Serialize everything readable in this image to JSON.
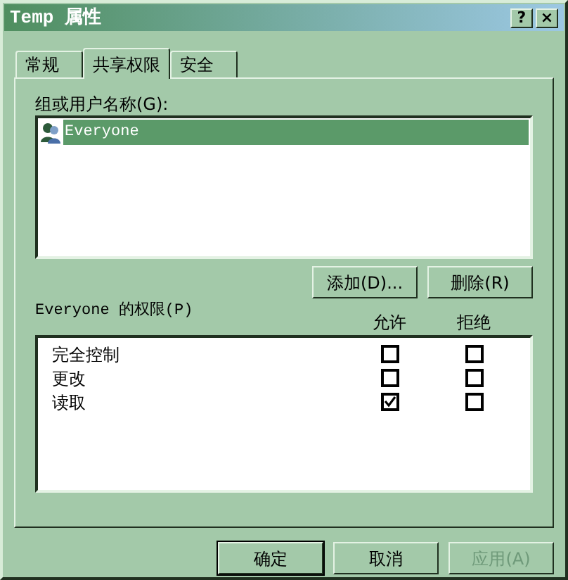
{
  "window": {
    "title": "Temp 属性",
    "controls": [
      "?",
      "×"
    ]
  },
  "tabs": [
    {
      "label": "常规",
      "selected": false
    },
    {
      "label": "共享权限",
      "selected": true
    },
    {
      "label": "安全",
      "selected": false
    }
  ],
  "group_label": "组或用户名称(G):",
  "users": [
    {
      "name": "Everyone",
      "selected": true
    }
  ],
  "user_buttons": [
    {
      "label": "添加(D)...",
      "disabled": false
    },
    {
      "label": "删除(R)",
      "disabled": false
    }
  ],
  "permissions_label": "Everyone 的权限(P)",
  "columns": [
    "允许",
    "拒绝"
  ],
  "permissions": [
    {
      "name": "完全控制",
      "allow": false,
      "deny": false
    },
    {
      "name": "更改",
      "allow": false,
      "deny": false
    },
    {
      "name": "读取",
      "allow": true,
      "deny": false
    }
  ],
  "footer_buttons": [
    {
      "label": "确定",
      "default": true,
      "disabled": false
    },
    {
      "label": "取消",
      "default": false,
      "disabled": false
    },
    {
      "label": "应用(A)",
      "default": false,
      "disabled": true
    }
  ]
}
